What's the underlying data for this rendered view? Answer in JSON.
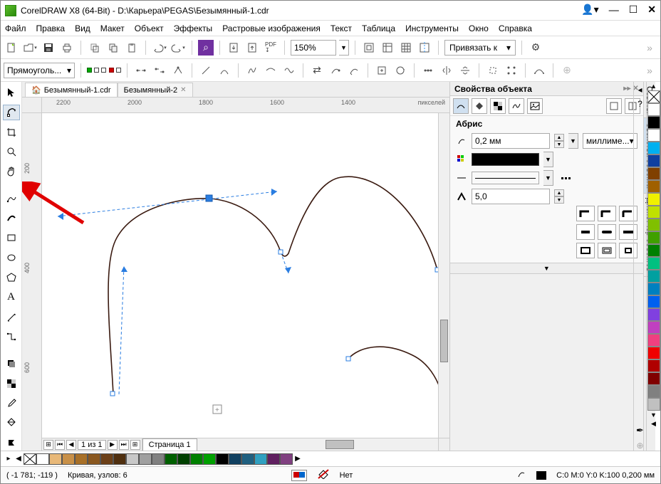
{
  "title": "CorelDRAW X8 (64-Bit) - D:\\Карьера\\PEGAS\\Безымянный-1.cdr",
  "menus": [
    "Файл",
    "Правка",
    "Вид",
    "Макет",
    "Объект",
    "Эффекты",
    "Растровые изображения",
    "Текст",
    "Таблица",
    "Инструменты",
    "Окно",
    "Справка"
  ],
  "zoom": "150%",
  "snap_label": "Привязать к",
  "prop_dropdown": "Прямоуголь...",
  "doc_tabs": [
    {
      "label": "Безымянный-1.cdr",
      "active": true,
      "home": true
    },
    {
      "label": "Безымянный-2",
      "active": false,
      "home": false
    }
  ],
  "ruler_h": [
    {
      "v": "2200",
      "px": 20
    },
    {
      "v": "2000",
      "px": 120
    },
    {
      "v": "1800",
      "px": 220
    },
    {
      "v": "1600",
      "px": 320
    },
    {
      "v": "1400",
      "px": 420
    }
  ],
  "ruler_h_units": "пикселей",
  "ruler_v": [
    {
      "v": "200",
      "px": 70
    },
    {
      "v": "400",
      "px": 210
    },
    {
      "v": "600",
      "px": 350
    }
  ],
  "page_nav": {
    "current": "1",
    "total": "из 1"
  },
  "page_tab": "Страница 1",
  "panel": {
    "title": "Свойства объекта",
    "section": "Абрис",
    "width": "0,2 мм",
    "units": "миллиме...",
    "miter": "5,0"
  },
  "side_tabs": [
    "Советы",
    "Свойства объекта",
    "Диспетчер объектов"
  ],
  "palette_h": [
    "#ffffff",
    "#e8b878",
    "#c89048",
    "#a87028",
    "#8a5820",
    "#6c4018",
    "#503010",
    "#c8c8c8",
    "#a0a0a0",
    "#808080",
    "#006000",
    "#004000",
    "#008000",
    "#00a000",
    "#000000",
    "#104060",
    "#206080",
    "#30a0c0",
    "#602060",
    "#804080"
  ],
  "palette_v": [
    "#ffffff",
    "#000000",
    "#ffffff",
    "#00b0f0",
    "#1040a0",
    "#804000",
    "#a06000",
    "#f0f000",
    "#c0e000",
    "#80c000",
    "#40a000",
    "#008000",
    "#00c080",
    "#00a0a0",
    "#0080c0",
    "#0060f0",
    "#8040e0",
    "#c040c0",
    "#f04080",
    "#f00000",
    "#b00000",
    "#800000",
    "#808080",
    "#c0c0c0"
  ],
  "status": {
    "coords": "( -1 781; -119 )",
    "curve": "Кривая, узлов: 6",
    "fill": "Нет",
    "outline": "C:0 M:0 Y:0 K:100  0,200 мм"
  },
  "chart_data": null
}
